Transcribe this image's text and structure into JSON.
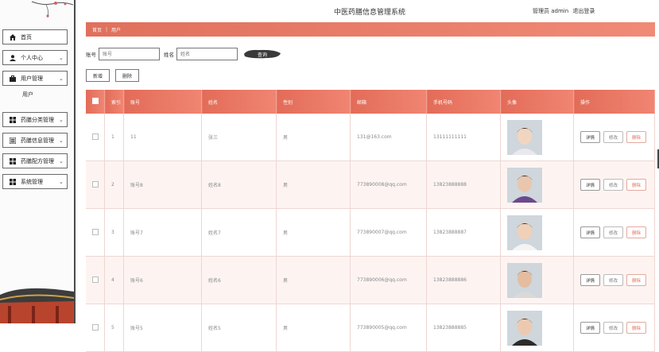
{
  "header": {
    "app_title": "中医药膳信息管理系统",
    "user_label": "管理员 admin",
    "logout_label": "退出登录"
  },
  "sidebar": {
    "items": [
      {
        "label": "首页",
        "icon": "home-icon"
      },
      {
        "label": "个人中心",
        "icon": "user-icon"
      },
      {
        "label": "用户管理",
        "icon": "briefcase-icon"
      },
      {
        "label": "药膳分类管理",
        "icon": "grid-icon"
      },
      {
        "label": "药膳信息管理",
        "icon": "list-icon"
      },
      {
        "label": "药膳配方管理",
        "icon": "grid-icon"
      },
      {
        "label": "系统管理",
        "icon": "grid-icon"
      }
    ],
    "sub_item": "用户"
  },
  "breadcrumb": {
    "home": "首页",
    "current": "用户"
  },
  "search": {
    "account_label": "账号",
    "account_placeholder": "账号",
    "name_label": "姓名",
    "name_placeholder": "姓名",
    "query_label": "查询"
  },
  "actions": {
    "add_label": "新增",
    "delete_label": "删除"
  },
  "table": {
    "headers": [
      "索引",
      "账号",
      "姓名",
      "性别",
      "邮箱",
      "手机号码",
      "头像",
      "操作"
    ],
    "op_labels": {
      "detail": "详情",
      "edit": "修改",
      "delete": "删除"
    },
    "rows": [
      {
        "index": "1",
        "account": "11",
        "name": "张三",
        "gender": "男",
        "email": "131@163.com",
        "phone": "13111111111"
      },
      {
        "index": "2",
        "account": "账号8",
        "name": "姓名8",
        "gender": "男",
        "email": "773890008@qq.com",
        "phone": "13823888888"
      },
      {
        "index": "3",
        "account": "账号7",
        "name": "姓名7",
        "gender": "男",
        "email": "773890007@qq.com",
        "phone": "13823888887"
      },
      {
        "index": "4",
        "account": "账号6",
        "name": "姓名6",
        "gender": "男",
        "email": "773890006@qq.com",
        "phone": "13823888886"
      },
      {
        "index": "5",
        "account": "账号5",
        "name": "姓名5",
        "gender": "男",
        "email": "773890005@qq.com",
        "phone": "13823888885"
      }
    ]
  },
  "colors": {
    "accent": "#e8735f",
    "sidebar_border": "#4b4b4b",
    "row_alt": "#fdf4f2"
  }
}
